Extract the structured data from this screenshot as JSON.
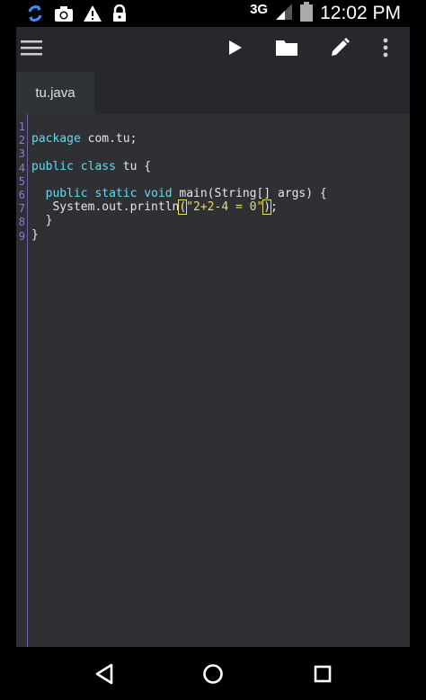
{
  "status_bar": {
    "network": "3G",
    "time": "12:02 PM",
    "icons": [
      "sync-icon",
      "camera-icon",
      "warning-icon",
      "lock-icon",
      "signal-icon",
      "battery-icon"
    ]
  },
  "toolbar": {
    "menu_icon": "hamburger-icon",
    "run_icon": "play-icon",
    "open_icon": "folder-icon",
    "edit_icon": "pencil-icon",
    "more_icon": "more-vert-icon"
  },
  "tabs": [
    {
      "label": "tu.java",
      "active": true
    }
  ],
  "editor": {
    "line_numbers": [
      "1",
      "2",
      "3",
      "4",
      "5",
      "6",
      "7",
      "8",
      "9"
    ],
    "lines": [
      {
        "kw": "package",
        "rest": " com.tu;"
      },
      {
        "kw": "",
        "rest": ""
      },
      {
        "kw": "public class",
        "rest": " tu {"
      },
      {
        "kw": "",
        "rest": ""
      },
      {
        "indent": "  ",
        "kw": "public static void",
        "rest": " main(String[] args) {"
      },
      {
        "pre": "   System.out.println",
        "open": "(",
        "str": "\"2+2-4 = 0\"",
        "close": ")",
        "post": ";"
      },
      {
        "rest": "  }"
      },
      {
        "rest": "}"
      },
      {
        "rest": ""
      }
    ]
  },
  "navbar": {
    "back_icon": "back-triangle-icon",
    "home_icon": "home-circle-icon",
    "recents_icon": "recents-square-icon"
  },
  "colors": {
    "editor_bg": "#2e3034",
    "toolbar_bg": "#26282d",
    "keyword": "#66d9ef",
    "string": "#e6db74",
    "line_number": "#8a7fd0"
  }
}
